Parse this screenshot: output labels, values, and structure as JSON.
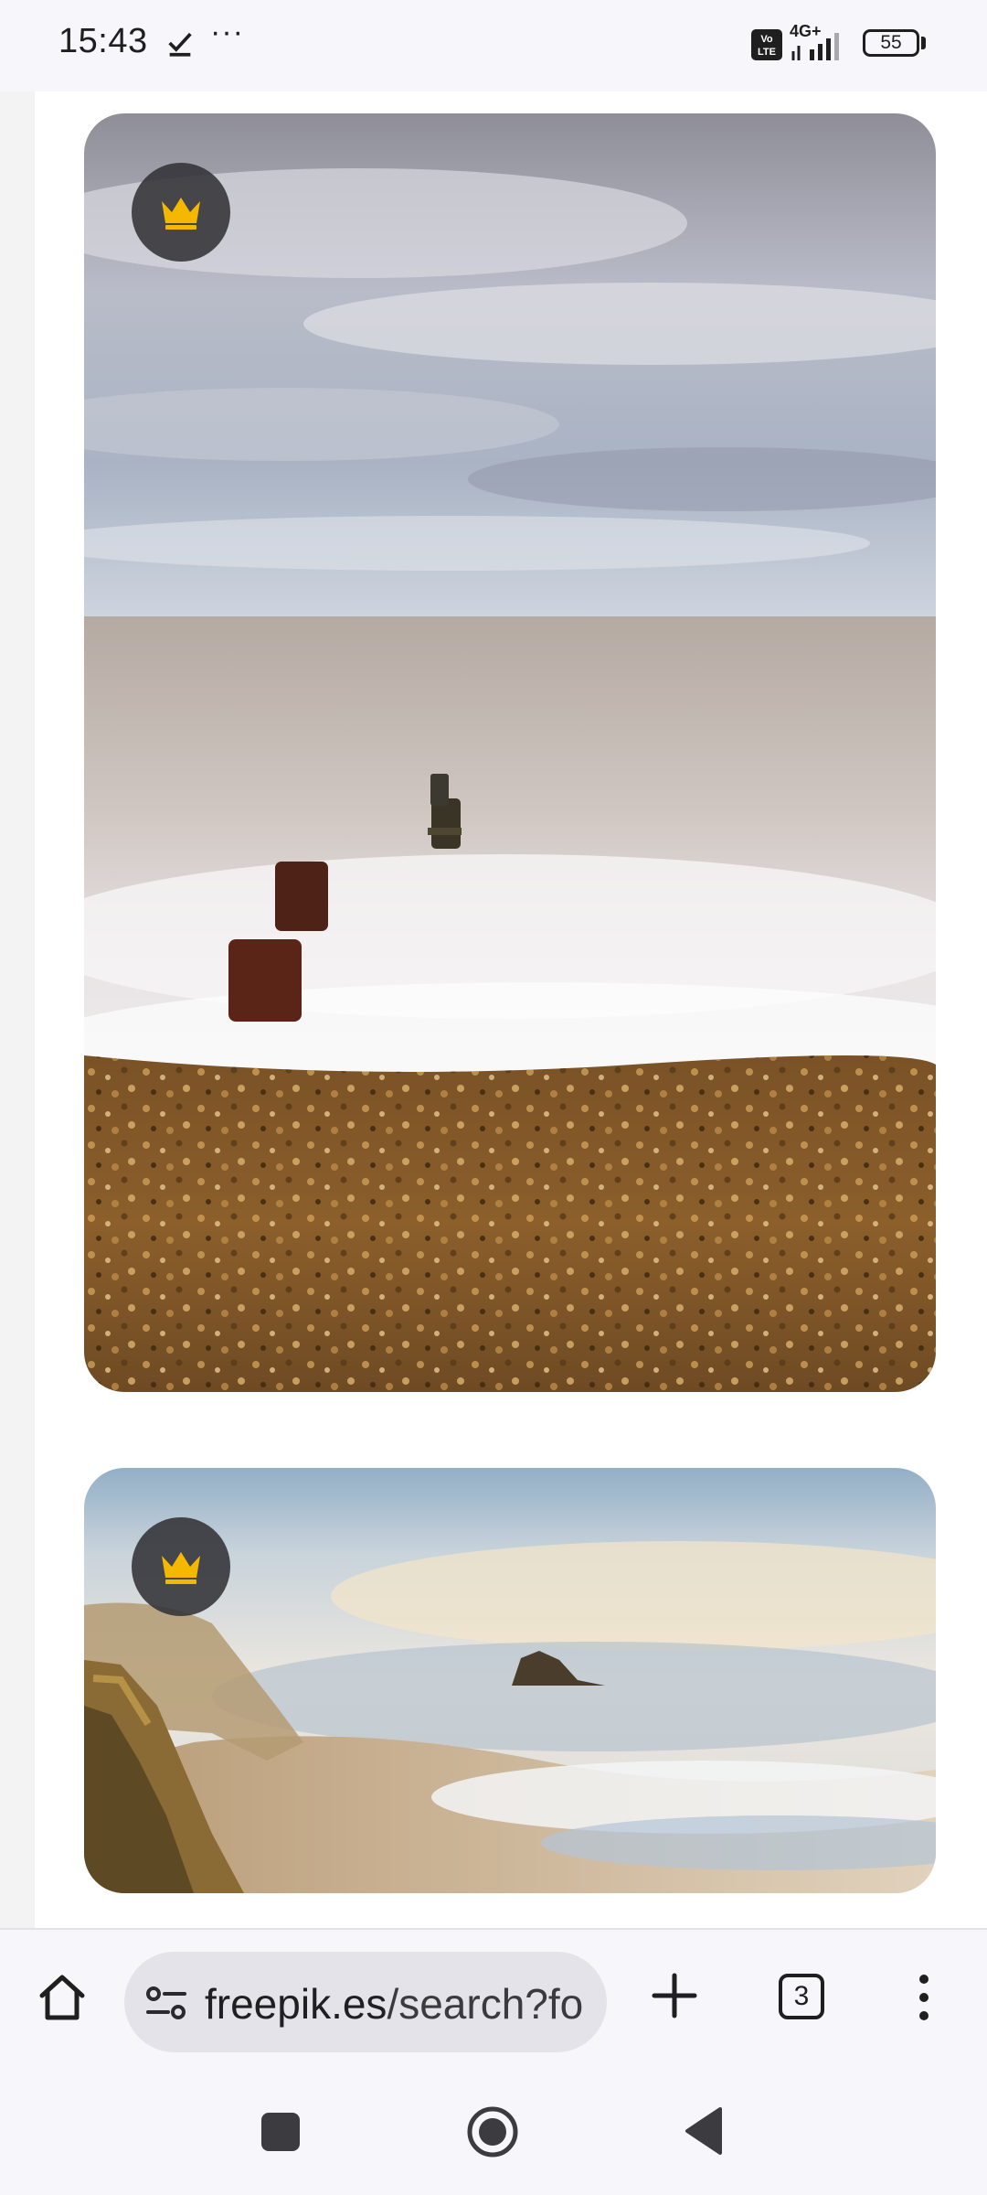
{
  "status_bar": {
    "time": "15:43",
    "more": "···",
    "network": "4G+",
    "volte": "Vo LTE",
    "battery": "55"
  },
  "gallery": {
    "cards": [
      {
        "name": "beach-groynes-long-exposure",
        "badge_icon": "crown-icon",
        "badge_color": "#f5b800"
      },
      {
        "name": "misty-coast-cliffs",
        "badge_icon": "crown-icon",
        "badge_color": "#f5b800"
      }
    ]
  },
  "browser": {
    "url_host": "freepik.es",
    "url_path": "/search?fo",
    "tab_count": "3"
  },
  "colors": {
    "premium_crown": "#f5b800",
    "badge_bg": "#323237",
    "url_pill": "#e4e3ea"
  }
}
